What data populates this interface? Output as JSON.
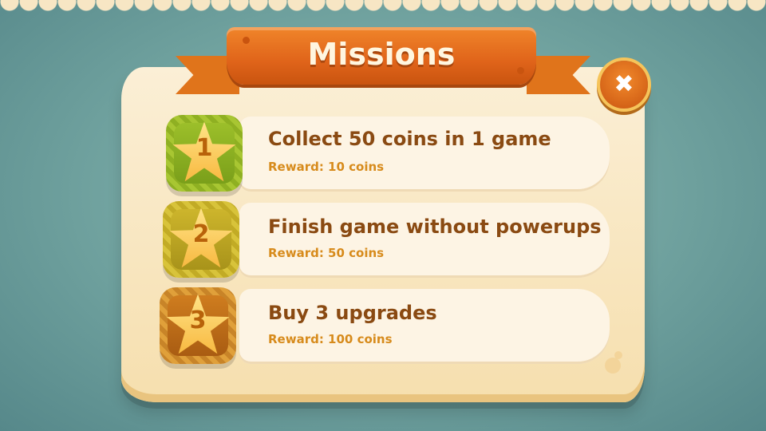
{
  "header": {
    "title": "Missions",
    "close_glyph": "✖"
  },
  "icons": {
    "close": "close-icon",
    "star": "star-icon"
  },
  "colors": {
    "ribbon": "#e0641a",
    "panel": "#fbefd6",
    "title_text": "#8a4a12",
    "reward_text": "#d78b1c"
  },
  "missions": [
    {
      "number": "1",
      "title": "Collect 50 coins in 1 game",
      "reward": "Reward: 10 coins",
      "badge_color": "#9cbf2a"
    },
    {
      "number": "2",
      "title": "Finish game without powerups",
      "reward": "Reward: 50 coins",
      "badge_color": "#cdb52c"
    },
    {
      "number": "3",
      "title": "Buy 3 upgrades",
      "reward": "Reward: 100 coins",
      "badge_color": "#cf7d1f"
    }
  ]
}
